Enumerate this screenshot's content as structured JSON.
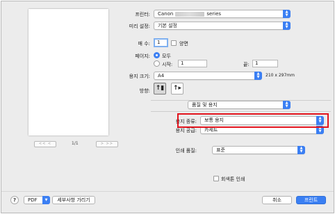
{
  "printer": {
    "label": "프린터:",
    "value_prefix": "Canon",
    "value_suffix": "series"
  },
  "presets": {
    "label": "미리 설정:",
    "value": "기본 설정"
  },
  "copies": {
    "label": "매 수:",
    "value": "1",
    "duplex_label": "양면"
  },
  "pages": {
    "label": "페이지:",
    "all_label": "모두",
    "from_label": "시작:",
    "from_value": "1",
    "to_label": "끝:",
    "to_value": "1"
  },
  "paper_size": {
    "label": "용지 크기:",
    "value": "A4",
    "dimensions": "210 x 297mm"
  },
  "orientation": {
    "label": "방향:"
  },
  "section": {
    "value": "품질 및 용지"
  },
  "media_type": {
    "label": "용지 종류:",
    "value": "보통 용지"
  },
  "paper_source": {
    "label": "용지 공급:",
    "value": "카세트"
  },
  "print_quality": {
    "label": "인쇄 품질:",
    "value": "표준"
  },
  "grayscale": {
    "label": "회색톤 인쇄"
  },
  "preview": {
    "prev_label": "<< <",
    "next_label": "> >>",
    "page_count": "1/1"
  },
  "bottom": {
    "help_label": "?",
    "pdf_label": "PDF",
    "hide_details_label": "세부사항 가리기",
    "cancel_label": "취소",
    "print_label": "프린트"
  },
  "colors": {
    "accent": "#3b7ff3",
    "highlight": "#e2141d"
  }
}
